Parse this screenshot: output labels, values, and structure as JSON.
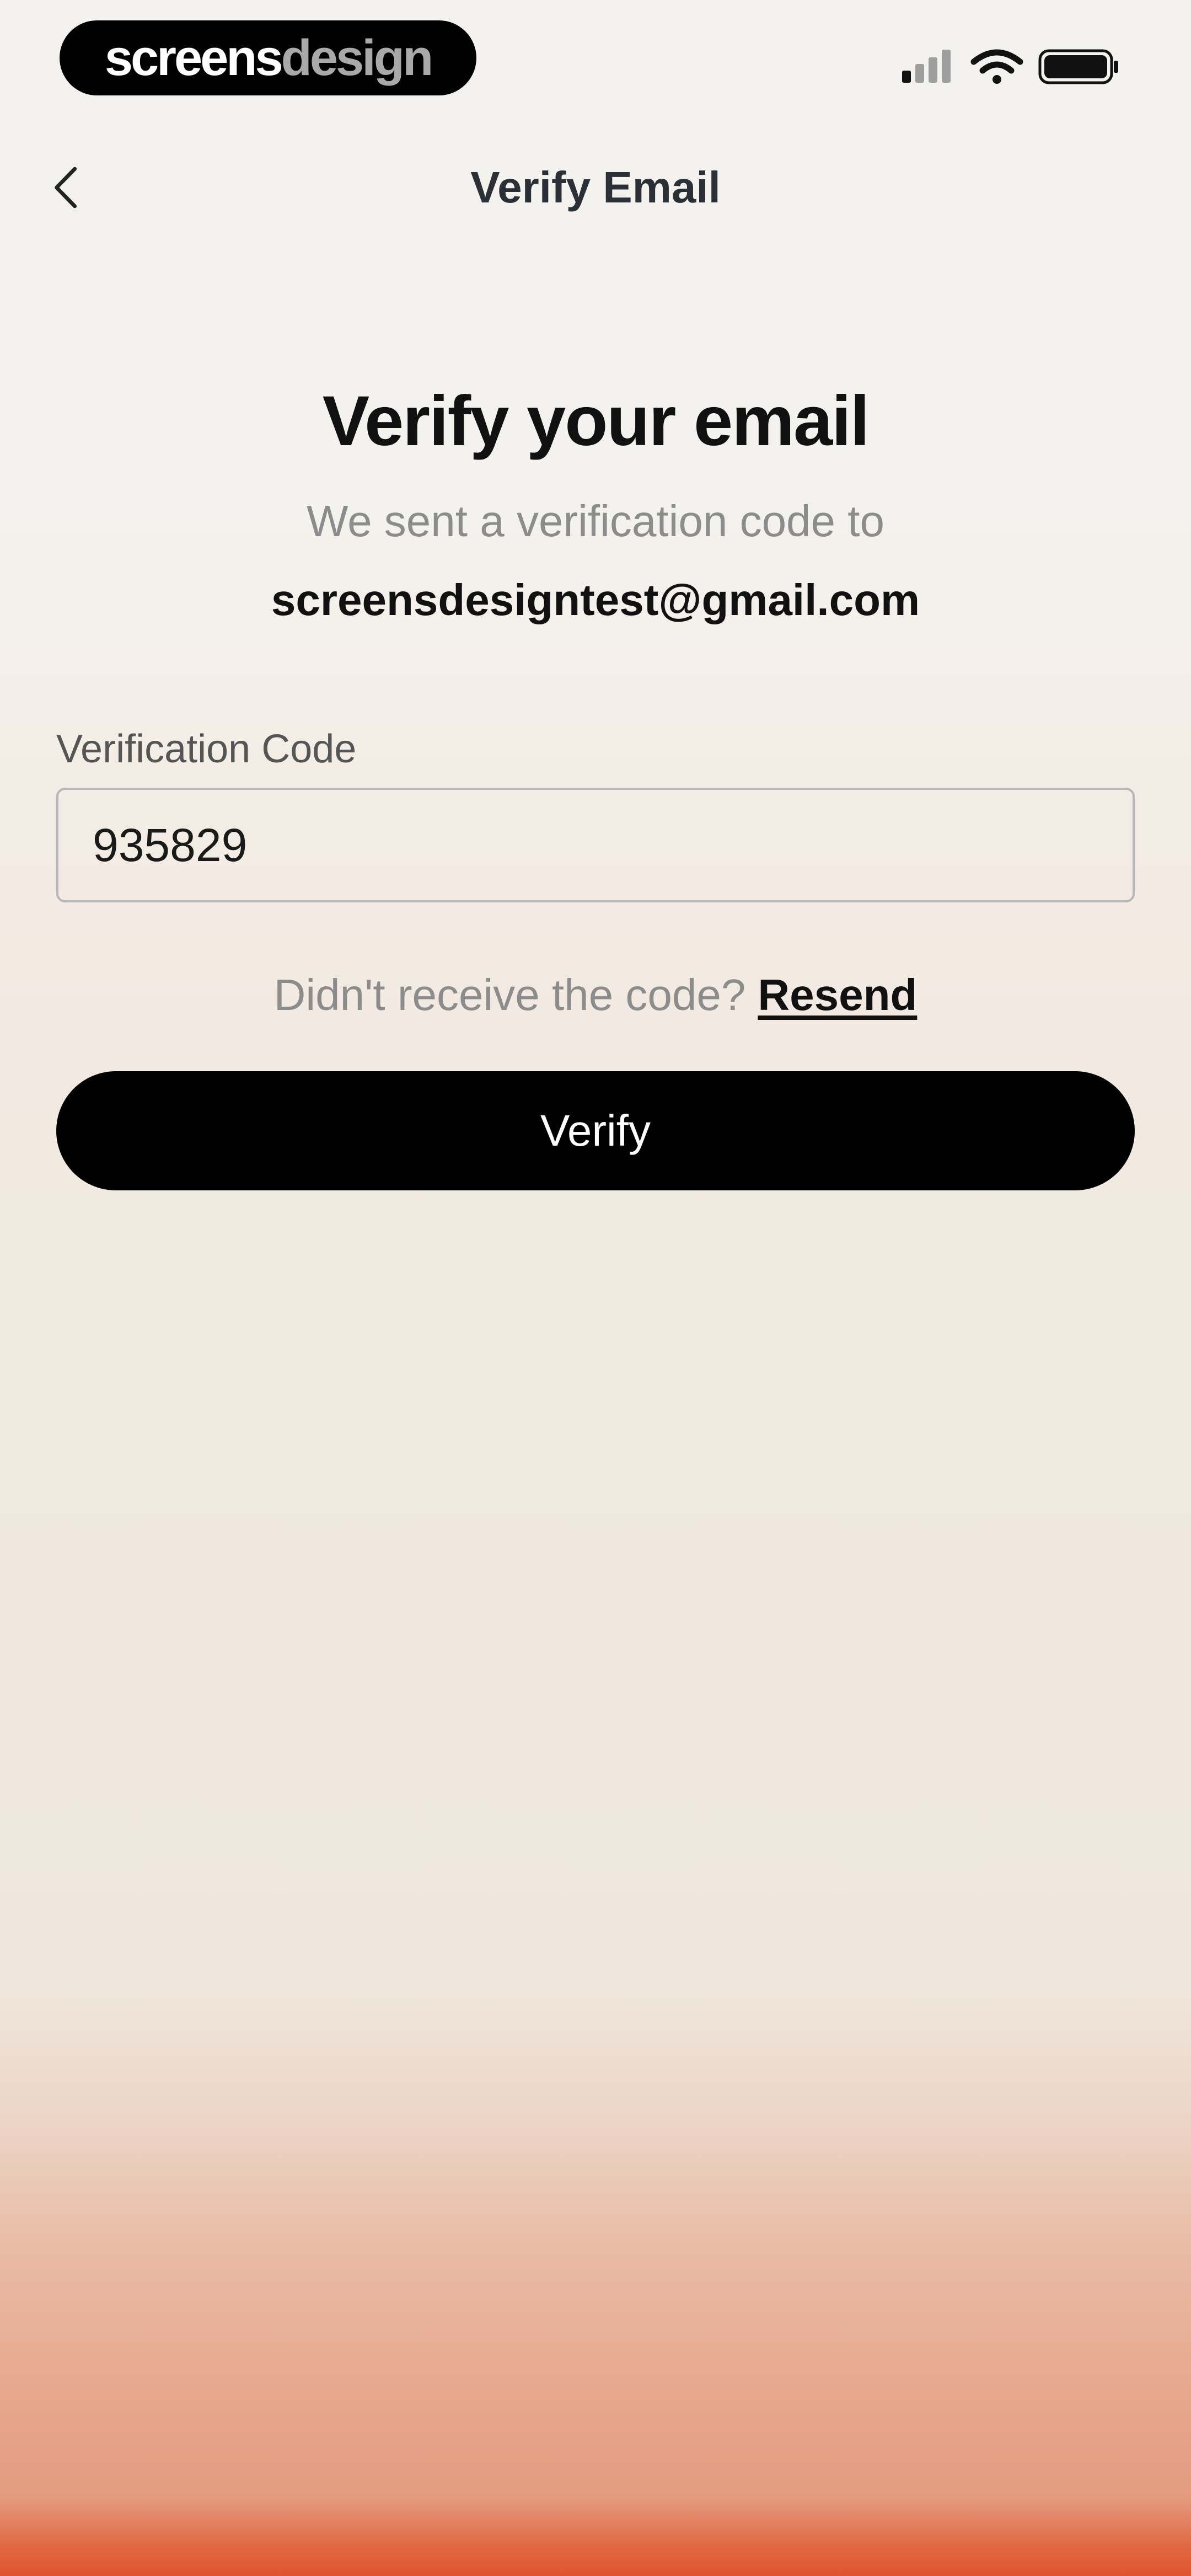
{
  "status_bar": {
    "brand_part1": "screens",
    "brand_part2": "design",
    "icons": [
      "cellular-signal-icon",
      "wifi-icon",
      "battery-icon"
    ]
  },
  "nav": {
    "title": "Verify Email",
    "back_icon": "chevron-left-icon"
  },
  "main": {
    "heading": "Verify your email",
    "subtext": "We sent a verification code to",
    "email": "screensdesigntest@gmail.com",
    "code_field": {
      "label": "Verification Code",
      "value": "935829"
    },
    "resend_prompt": "Didn't receive the code?",
    "resend_link": "Resend",
    "verify_button": "Verify"
  },
  "colors": {
    "primary": "#000000",
    "text": "#111111",
    "muted_text": "#8c8c8c",
    "background_top": "#f3f2ef",
    "background_bottom": "#df5530"
  }
}
